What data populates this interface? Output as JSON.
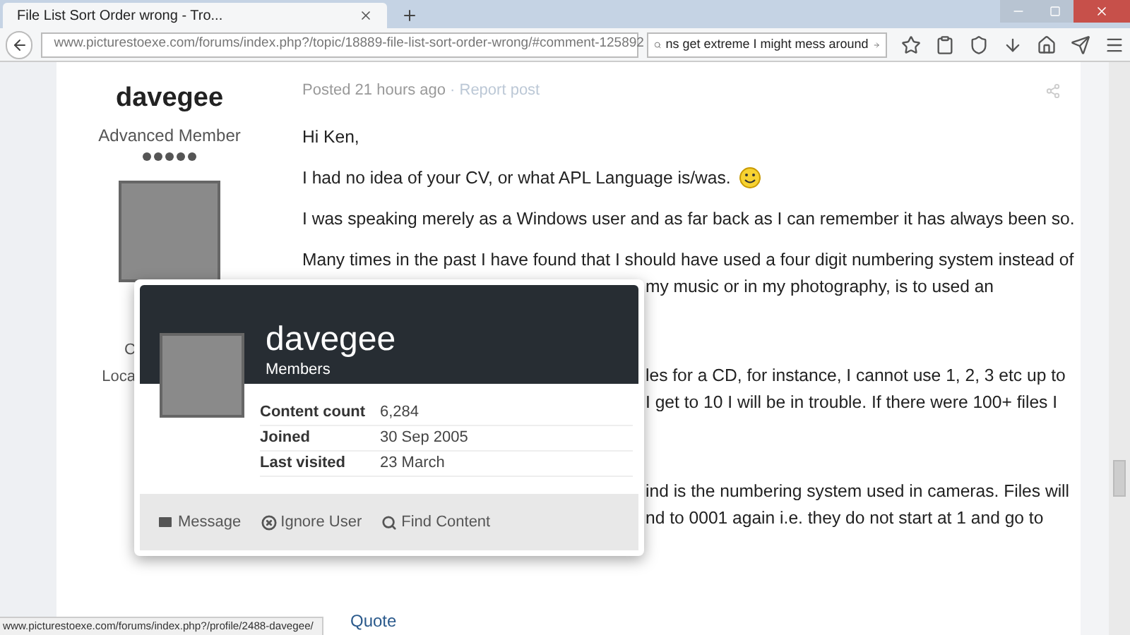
{
  "browser": {
    "tab_title": "File List Sort Order wrong - Tro...",
    "url": "www.picturestoexe.com/forums/index.php?/topic/18889-file-list-sort-order-wrong/#comment-125892",
    "search": "ns get extreme I might mess around",
    "status_url": "www.picturestoexe.com/forums/index.php?/profile/2488-davegee/"
  },
  "author": {
    "name": "davegee",
    "rank": "Advanced Member",
    "stars": 5,
    "partial_labels": [
      "C",
      "Loca"
    ]
  },
  "post": {
    "posted": "Posted 21 hours ago",
    "report": "· Report post",
    "paragraphs": [
      {
        "kind": "text",
        "text": "Hi Ken,"
      },
      {
        "kind": "text_emoji",
        "text": "I had no idea of your CV, or what APL Language is/was."
      },
      {
        "kind": "text",
        "text": "I was speaking merely as a Windows user and as far back as I can remember it has always been so."
      },
      {
        "kind": "text",
        "text": "Many times in the past I have found that I should have used a four digit numbering system instead of"
      }
    ],
    "fragments": [
      {
        "kind": "line",
        "text": "my music or in my photography, is to used an"
      },
      {
        "kind": "paragraph",
        "text": "les for a CD, for instance, I cannot use 1, 2, 3 etc up to"
      },
      {
        "kind": "line",
        "text": "I get to 10 I will be in trouble. If there were 100+ files I"
      },
      {
        "kind": "paragraph",
        "text": "ind is the numbering system used in cameras. Files will"
      },
      {
        "kind": "line",
        "text": "nd to 0001 again i.e. they do not start at 1 and go to"
      }
    ],
    "quote": "Quote"
  },
  "profile_card": {
    "name": "davegee",
    "group": "Members",
    "stats": [
      {
        "label": "Content count",
        "value": "6,284"
      },
      {
        "label": "Joined",
        "value": "30 Sep 2005"
      },
      {
        "label": "Last visited",
        "value": "23 March"
      }
    ],
    "actions": [
      {
        "kind": "message",
        "label": "Message"
      },
      {
        "kind": "ignore",
        "label": "Ignore User"
      },
      {
        "kind": "find",
        "label": "Find Content"
      }
    ]
  }
}
